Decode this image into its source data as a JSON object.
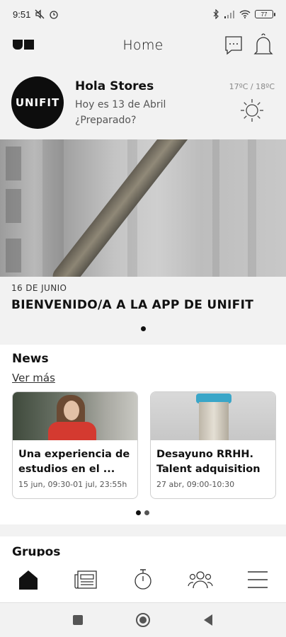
{
  "status": {
    "time": "9:51",
    "battery": "77"
  },
  "header": {
    "title": "Home",
    "brand_logo": "UN"
  },
  "greeting": {
    "brand": "UNIFIT",
    "name": "Hola Stores",
    "date": "Hoy es 13 de Abril",
    "question": "¿Preparado?",
    "temperature": "17ºC / 18ºC",
    "weather_icon": "sun-icon"
  },
  "hero": {
    "date": "16 DE JUNIO",
    "title": "BIENVENIDO/A A LA APP DE UNIFIT"
  },
  "news": {
    "title": "News",
    "more_label": "Ver más",
    "items": [
      {
        "title": "Una experiencia de estudios en el ...",
        "subtitle": "15 jun, 09:30-01 jul, 23:55h"
      },
      {
        "title": "Desayuno RRHH. Talent adquisition",
        "subtitle": "27 abr, 09:00-10:30"
      }
    ]
  },
  "grupos": {
    "title": "Grupos"
  },
  "bottom_nav": {
    "items": [
      {
        "icon": "home-icon",
        "active": true
      },
      {
        "icon": "news-icon",
        "active": false
      },
      {
        "icon": "stopwatch-icon",
        "active": false
      },
      {
        "icon": "groups-icon",
        "active": false
      },
      {
        "icon": "menu-icon",
        "active": false
      }
    ]
  },
  "colors": {
    "background": "#f2f2f2",
    "text": "#111111",
    "brand": "#0d0d0d"
  }
}
